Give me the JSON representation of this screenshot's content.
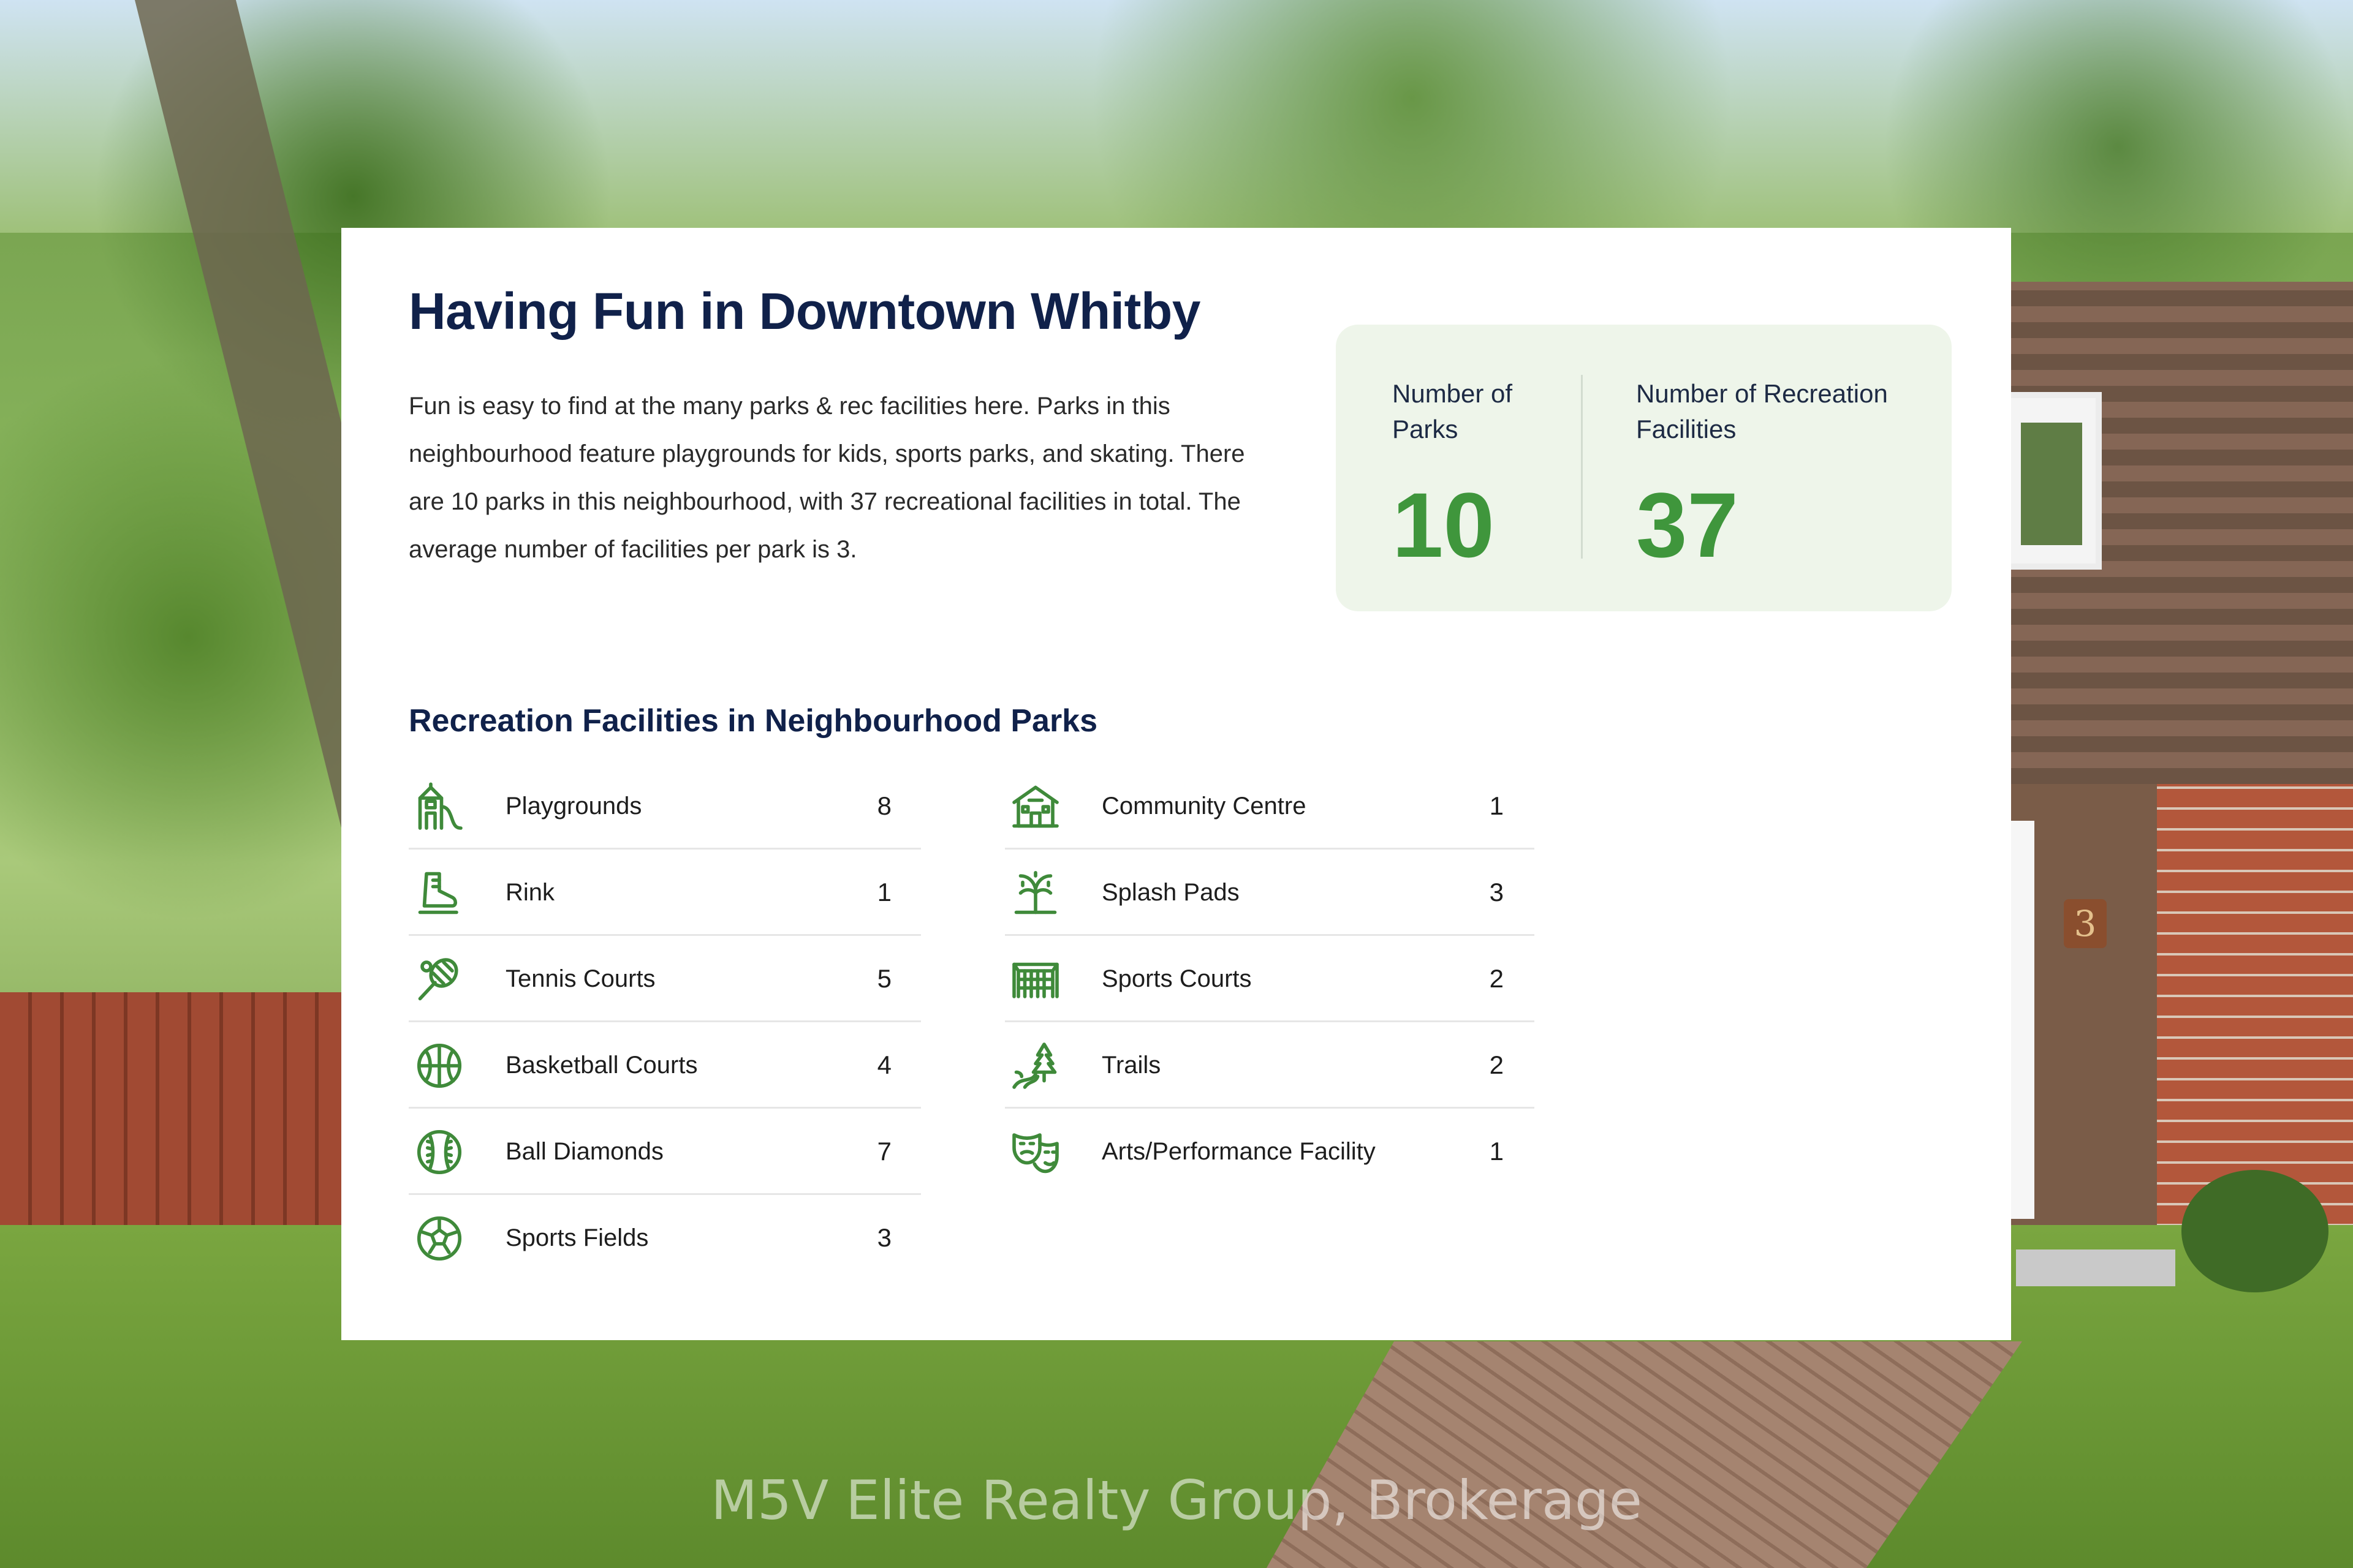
{
  "card": {
    "title": "Having Fun in Downtown Whitby",
    "description": "Fun is easy to find at the many parks & rec facilities here. Parks in this neighbourhood feature playgrounds for kids, sports parks, and skating. There are 10 parks in this neighbourhood, with 37 recreational facilities in total. The average number of facilities per park is 3."
  },
  "stats": {
    "parks_label": "Number of Parks",
    "parks_value": "10",
    "facilities_label": "Number of Recreation Facilities",
    "facilities_value": "37"
  },
  "facilities": {
    "section_title": "Recreation Facilities in Neighbourhood Parks",
    "left": [
      {
        "name": "Playgrounds",
        "count": "8",
        "icon": "playground-icon"
      },
      {
        "name": "Rink",
        "count": "1",
        "icon": "skate-icon"
      },
      {
        "name": "Tennis Courts",
        "count": "5",
        "icon": "tennis-icon"
      },
      {
        "name": "Basketball Courts",
        "count": "4",
        "icon": "basketball-icon"
      },
      {
        "name": "Ball Diamonds",
        "count": "7",
        "icon": "baseball-icon"
      },
      {
        "name": "Sports Fields",
        "count": "3",
        "icon": "soccer-ball-icon"
      }
    ],
    "right": [
      {
        "name": "Community Centre",
        "count": "1",
        "icon": "community-centre-icon"
      },
      {
        "name": "Splash Pads",
        "count": "3",
        "icon": "splash-pad-icon"
      },
      {
        "name": "Sports Courts",
        "count": "2",
        "icon": "sports-court-icon"
      },
      {
        "name": "Trails",
        "count": "2",
        "icon": "trail-icon"
      },
      {
        "name": "Arts/Performance Facility",
        "count": "1",
        "icon": "theatre-masks-icon"
      }
    ]
  },
  "watermark": "M5V Elite Realty Group, Brokerage",
  "colors": {
    "heading": "#10214a",
    "accent_green": "#3f963c",
    "stats_bg": "#eef5ea"
  }
}
